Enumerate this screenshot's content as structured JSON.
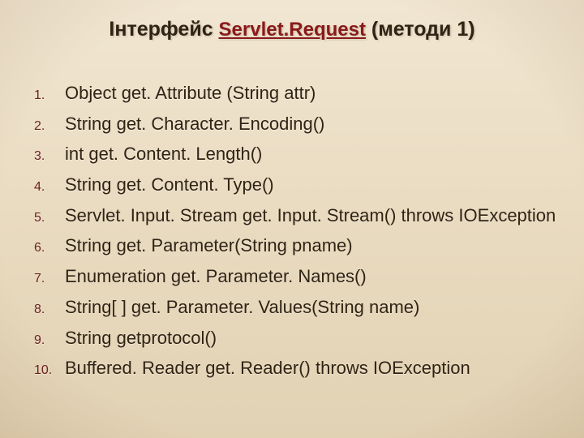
{
  "title": {
    "prefix": "Інтерфейс",
    "redlink": "Servlet.Request",
    "suffix": "(методи 1)"
  },
  "items": [
    {
      "num": "1.",
      "text": "Object get. Attribute (String attr)"
    },
    {
      "num": "2.",
      "text": "String get. Character. Encoding()"
    },
    {
      "num": "3.",
      "text": "int get. Content. Length()"
    },
    {
      "num": "4.",
      "text": "String get. Content. Type()"
    },
    {
      "num": "5.",
      "text": "Servlet. Input. Stream  get. Input. Stream() throws IOException"
    },
    {
      "num": "6.",
      "text": "String get. Parameter(String pname)"
    },
    {
      "num": "7.",
      "text": "Enumeration get. Parameter. Names()"
    },
    {
      "num": "8.",
      "text": "String[ ] get. Parameter. Values(String name)"
    },
    {
      "num": "9.",
      "text": "String getprotocol()"
    },
    {
      "num": "10.",
      "text": "Buffered. Reader get. Reader() throws IOException"
    }
  ]
}
